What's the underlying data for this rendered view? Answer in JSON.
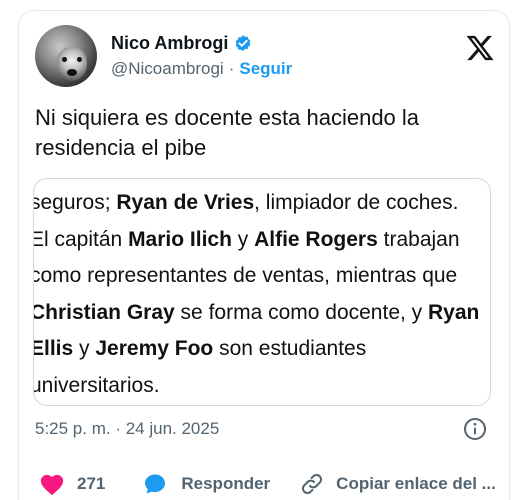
{
  "author": {
    "display_name": "Nico Ambrogi",
    "handle": "@Nicoambrogi",
    "separator": "·",
    "follow_label": "Seguir"
  },
  "tweet": {
    "text": "Ni siquiera es docente esta haciendo la residencia el pibe"
  },
  "quote": {
    "line1": {
      "pre": "seguros; ",
      "b1": "Ryan de Vries",
      "post": ", limpiador de coches."
    },
    "line2": {
      "pre": "El capitán ",
      "b1": "Mario Ilich",
      "mid": " y ",
      "b2": "Alfie Rogers",
      "post": " trabajan"
    },
    "line3": {
      "text": "como representantes de ventas, mientras que"
    },
    "line4": {
      "b1": "Christian Gray",
      "mid": " se forma como docente, y ",
      "b2": "Ryan"
    },
    "line5": {
      "b1": "Ellis",
      "mid": " y ",
      "b2": "Jeremy Foo",
      "post": " son estudiantes"
    },
    "line6": {
      "text": "universitarios."
    }
  },
  "meta": {
    "timestamp": "5:25 p. m. · 24 jun. 2025"
  },
  "actions": {
    "likes_count": "271",
    "reply_label": "Responder",
    "copy_label": "Copiar enlace del ..."
  },
  "icons": {
    "verified": "verified-badge-icon",
    "x_logo": "x-logo-icon",
    "info": "info-icon",
    "like": "heart-icon",
    "reply": "reply-bubble-icon",
    "copy": "link-icon"
  },
  "colors": {
    "accent": "#1d9bf0",
    "like": "#f91880",
    "secondary_text": "#536471"
  }
}
